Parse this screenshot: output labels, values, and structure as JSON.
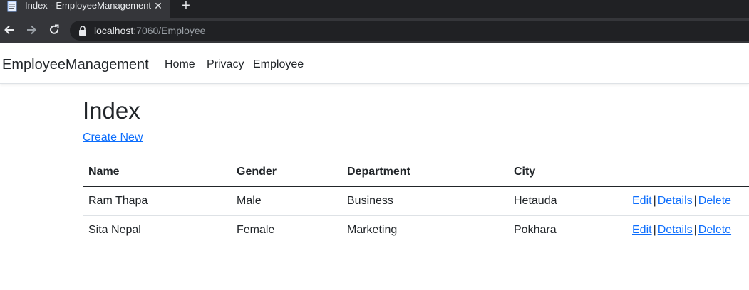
{
  "browser": {
    "tab_title": "Index - EmployeeManagement",
    "tab_close": "✕",
    "new_tab": "+",
    "url_host": "localhost",
    "url_rest": ":7060/Employee"
  },
  "navbar": {
    "brand": "EmployeeManagement",
    "links": [
      "Home",
      "Privacy",
      "Employee"
    ]
  },
  "page": {
    "title": "Index",
    "create_link": "Create New"
  },
  "table": {
    "headers": [
      "Name",
      "Gender",
      "Department",
      "City"
    ],
    "rows": [
      {
        "name": "Ram Thapa",
        "gender": "Male",
        "department": "Business",
        "city": "Hetauda"
      },
      {
        "name": "Sita Nepal",
        "gender": "Female",
        "department": "Marketing",
        "city": "Pokhara"
      }
    ],
    "actions": {
      "edit": "Edit",
      "details": "Details",
      "delete": "Delete",
      "separator": "|"
    }
  },
  "colors": {
    "link": "#0d6efd",
    "text": "#212529",
    "chrome_dark": "#202124",
    "chrome_toolbar": "#35363a"
  },
  "icons": [
    "document-favicon-icon",
    "close-icon",
    "plus-icon",
    "back-arrow-icon",
    "forward-arrow-icon",
    "reload-icon",
    "lock-icon"
  ]
}
